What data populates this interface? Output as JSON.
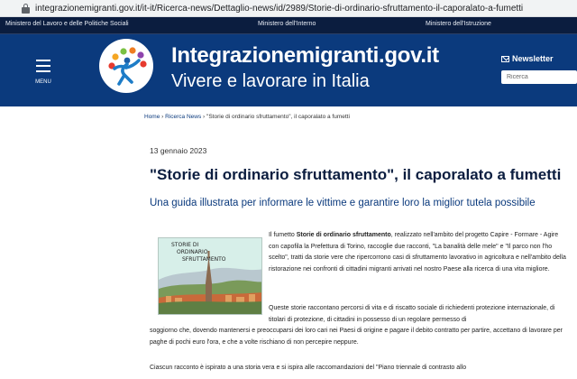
{
  "browser": {
    "url": "integrazionemigranti.gov.it/it-it/Ricerca-news/Dettaglio-news/id/2989/Storie-di-ordinario-sfruttamento-il-caporalato-a-fumetti"
  },
  "ministries": [
    "Ministero del Lavoro e delle Politiche Sociali",
    "Ministero dell'Interno",
    "Ministero dell'Istruzione"
  ],
  "header": {
    "menu_label": "MENU",
    "site_title": "Integrazionemigranti.gov.it",
    "site_subtitle": "Vivere e lavorare in Italia",
    "newsletter_label": "Newsletter",
    "search_placeholder": "Ricerca"
  },
  "breadcrumb": {
    "home": "Home",
    "separator": "›",
    "section": "Ricerca News",
    "current": "\"Storie di ordinario sfruttamento\", il caporalato a fumetti"
  },
  "article": {
    "date": "13 gennaio 2023",
    "title": "\"Storie di ordinario sfruttamento\", il caporalato a fumetti",
    "subtitle": "Una guida illustrata per informare le vittime e garantire loro la miglior tutela possibile",
    "image_caption": [
      "STORIE DI",
      "ORDINARIO",
      "SFRUTTAMENTO"
    ],
    "p1_pre": "Il fumetto ",
    "p1_bold": "Storie di ordinario sfruttamento",
    "p1_post": ", realizzato nell'ambito del progetto Capire - Formare - Agire con capofila la Prefettura di Torino, raccoglie due racconti, \"La banalità delle mele\" e \"Il parco non l'ho scelto\", tratti da storie vere che ripercorrono casi di sfruttamento lavorativo in agricoltura e nell'ambito della ristorazione nei confronti di cittadini migranti arrivati nel nostro Paese alla ricerca di una vita migliore.",
    "p2_a": "Queste storie raccontano percorsi di vita e di riscatto sociale di richiedenti protezione internazionale, di titolari di protezione, di cittadini in possesso di un regolare permesso di",
    "p2_b": "soggiorno che, dovendo mantenersi e preoccuparsi dei loro cari nei Paesi di origine e pagare il debito contratto per partire, accettano di lavorare per paghe di pochi euro l'ora, e che a volte rischiano di non percepire neppure.",
    "p3": "Ciascun racconto è ispirato a una storia vera e si ispira alle raccomandazioni del \"Piano triennale di contrasto allo"
  },
  "colors": {
    "top_bar": "#0b1d3f",
    "header_blue": "#0b3a7d",
    "title_navy": "#0b1d3f",
    "link_blue": "#0b3a7d"
  }
}
